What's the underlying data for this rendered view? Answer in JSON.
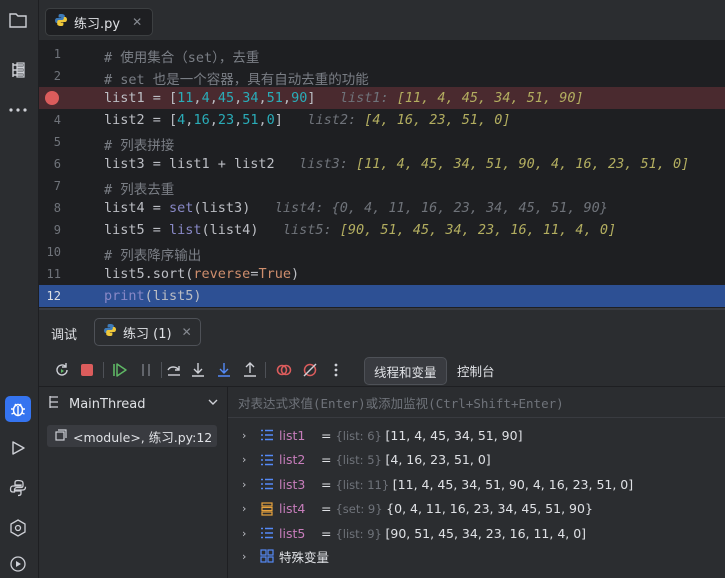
{
  "editor": {
    "file_tab": "练习.py",
    "lines": [
      {
        "num": "1",
        "segments": [
          {
            "t": "# 使用集合（set），去重",
            "c": "cm"
          }
        ]
      },
      {
        "num": "2",
        "segments": [
          {
            "t": "# set 也是一个容器，具有自动去重的功能",
            "c": "cm"
          }
        ]
      },
      {
        "num": "3",
        "breakpoint": true,
        "segments": [
          {
            "t": "list1 = [",
            "c": ""
          },
          {
            "t": "11",
            "c": "num"
          },
          {
            "t": ",",
            "c": ""
          },
          {
            "t": "4",
            "c": "num"
          },
          {
            "t": ",",
            "c": ""
          },
          {
            "t": "45",
            "c": "num"
          },
          {
            "t": ",",
            "c": ""
          },
          {
            "t": "34",
            "c": "num"
          },
          {
            "t": ",",
            "c": ""
          },
          {
            "t": "51",
            "c": "num"
          },
          {
            "t": ",",
            "c": ""
          },
          {
            "t": "90",
            "c": "num"
          },
          {
            "t": "]   ",
            "c": ""
          },
          {
            "t": "list1: ",
            "c": "hint"
          },
          {
            "t": "[11, 4, 45, 34, 51, 90]",
            "c": "hint-v"
          }
        ]
      },
      {
        "num": "4",
        "segments": [
          {
            "t": "list2 = [",
            "c": ""
          },
          {
            "t": "4",
            "c": "num"
          },
          {
            "t": ",",
            "c": ""
          },
          {
            "t": "16",
            "c": "num"
          },
          {
            "t": ",",
            "c": ""
          },
          {
            "t": "23",
            "c": "num"
          },
          {
            "t": ",",
            "c": ""
          },
          {
            "t": "51",
            "c": "num"
          },
          {
            "t": ",",
            "c": ""
          },
          {
            "t": "0",
            "c": "num"
          },
          {
            "t": "]   ",
            "c": ""
          },
          {
            "t": "list2: ",
            "c": "hint"
          },
          {
            "t": "[4, 16, 23, 51, 0]",
            "c": "hint-v"
          }
        ]
      },
      {
        "num": "5",
        "segments": [
          {
            "t": "# 列表拼接",
            "c": "cm"
          }
        ]
      },
      {
        "num": "6",
        "segments": [
          {
            "t": "list3 = list1 + list2   ",
            "c": ""
          },
          {
            "t": "list3: ",
            "c": "hint"
          },
          {
            "t": "[11, 4, 45, 34, 51, 90, 4, 16, 23, 51, 0]",
            "c": "hint-v"
          }
        ]
      },
      {
        "num": "7",
        "segments": [
          {
            "t": "# 列表去重",
            "c": "cm"
          }
        ]
      },
      {
        "num": "8",
        "segments": [
          {
            "t": "list4 = ",
            "c": ""
          },
          {
            "t": "set",
            "c": "bi"
          },
          {
            "t": "(list3)   ",
            "c": ""
          },
          {
            "t": "list4: {0, 4, 11, 16, 23, 34, 45, 51, 90}",
            "c": "hint"
          }
        ]
      },
      {
        "num": "9",
        "segments": [
          {
            "t": "list5 = ",
            "c": ""
          },
          {
            "t": "list",
            "c": "bi"
          },
          {
            "t": "(list4)   ",
            "c": ""
          },
          {
            "t": "list5: ",
            "c": "hint"
          },
          {
            "t": "[90, 51, 45, 34, 23, 16, 11, 4, 0]",
            "c": "hint-v"
          }
        ]
      },
      {
        "num": "10",
        "segments": [
          {
            "t": "# 列表降序输出",
            "c": "cm"
          }
        ]
      },
      {
        "num": "11",
        "segments": [
          {
            "t": "list5.sort(",
            "c": ""
          },
          {
            "t": "reverse",
            "c": "kw"
          },
          {
            "t": "=",
            "c": ""
          },
          {
            "t": "True",
            "c": "kw"
          },
          {
            "t": ")",
            "c": ""
          }
        ]
      },
      {
        "num": "12",
        "current": true,
        "segments": [
          {
            "t": "print",
            "c": "bi"
          },
          {
            "t": "(list5)",
            "c": ""
          }
        ]
      }
    ]
  },
  "debug": {
    "title": "调试",
    "session_tab": "练习 (1)",
    "tab_threads_vars": "线程和变量",
    "tab_console": "控制台",
    "thread": "MainThread",
    "frame": "<module>, 练习.py:12",
    "eval_placeholder": "对表达式求值(Enter)或添加监视(Ctrl+Shift+Enter)"
  },
  "variables": [
    {
      "name": "list1",
      "type": "{list: 6}",
      "value": "[11, 4, 45, 34, 51, 90]",
      "icon": "list-icon"
    },
    {
      "name": "list2",
      "type": "{list: 5}",
      "value": "[4, 16, 23, 51, 0]",
      "icon": "list-icon"
    },
    {
      "name": "list3",
      "type": "{list: 11}",
      "value": "[11, 4, 45, 34, 51, 90, 4, 16, 23, 51, 0]",
      "icon": "list-icon"
    },
    {
      "name": "list4",
      "type": "{set: 9}",
      "value": "{0, 4, 11, 16, 23, 34, 45, 51, 90}",
      "icon": "set-icon"
    },
    {
      "name": "list5",
      "type": "{list: 9}",
      "value": "[90, 51, 45, 34, 23, 16, 11, 4, 0]",
      "icon": "list-icon"
    }
  ],
  "special_vars": "特殊变量",
  "colors": {
    "accent": "#3574f0",
    "breakpoint": "#db5c5c",
    "current_line": "#2d5094"
  }
}
